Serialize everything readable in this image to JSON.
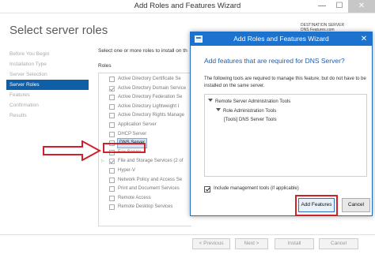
{
  "wizard": {
    "title": "Add Roles and Features Wizard",
    "window_controls": {
      "minimize": "—",
      "maximize": "☐",
      "close": "✕"
    },
    "heading": "Select server roles",
    "destination_label": "DESTINATION SERVER",
    "destination_server": "DNS Features.com",
    "nav": [
      "Before You Begin",
      "Installation Type",
      "Server Selection",
      "Server Roles",
      "Features",
      "Confirmation",
      "Results"
    ],
    "active_nav": "Server Roles",
    "instruction": "Select one or more roles to install on th",
    "roles_header": "Roles",
    "roles": [
      {
        "label": "Active Directory Certificate Se",
        "checked": false,
        "expandable": false
      },
      {
        "label": "Active Directory Domain Service",
        "checked": true,
        "expandable": false
      },
      {
        "label": "Active Directory Federation Se",
        "checked": false,
        "expandable": false
      },
      {
        "label": "Active Directory Lightweight I",
        "checked": false,
        "expandable": false
      },
      {
        "label": "Active Directory Rights Manage",
        "checked": false,
        "expandable": false
      },
      {
        "label": "Application Server",
        "checked": false,
        "expandable": false
      },
      {
        "label": "DHCP Server",
        "checked": false,
        "expandable": false
      },
      {
        "label": "DNS Server",
        "checked": false,
        "expandable": false,
        "selected": true
      },
      {
        "label": "Fax Server",
        "checked": false,
        "expandable": false
      },
      {
        "label": "File and Storage Services (2 of",
        "checked": true,
        "expandable": true
      },
      {
        "label": "Hyper-V",
        "checked": false,
        "expandable": false
      },
      {
        "label": "Network Policy and Access Se",
        "checked": false,
        "expandable": false
      },
      {
        "label": "Print and Document Services",
        "checked": false,
        "expandable": false
      },
      {
        "label": "Remote Access",
        "checked": false,
        "expandable": false
      },
      {
        "label": "Remote Desktop Services",
        "checked": false,
        "expandable": false
      }
    ],
    "buttons": {
      "previous": "< Previous",
      "next": "Next >",
      "install": "Install",
      "cancel": "Cancel"
    }
  },
  "dialog": {
    "title": "Add Roles and Features Wizard",
    "close": "✕",
    "heading": "Add features that are required for DNS Server?",
    "description": "The following tools are required to manage this feature, but do not have to be installed on the same server.",
    "tree": [
      {
        "label": "Remote Server Administration Tools",
        "level": 0,
        "expanded": true
      },
      {
        "label": "Role Administration Tools",
        "level": 1,
        "expanded": true
      },
      {
        "label": "[Tools] DNS Server Tools",
        "level": 2,
        "expanded": false
      }
    ],
    "include_tools_label": "Include management tools (if applicable)",
    "include_tools_checked": true,
    "add_features_label": "Add Features",
    "cancel_label": "Cancel"
  },
  "annotation_color": "#d0202a",
  "accent_color": "#1c73cf"
}
